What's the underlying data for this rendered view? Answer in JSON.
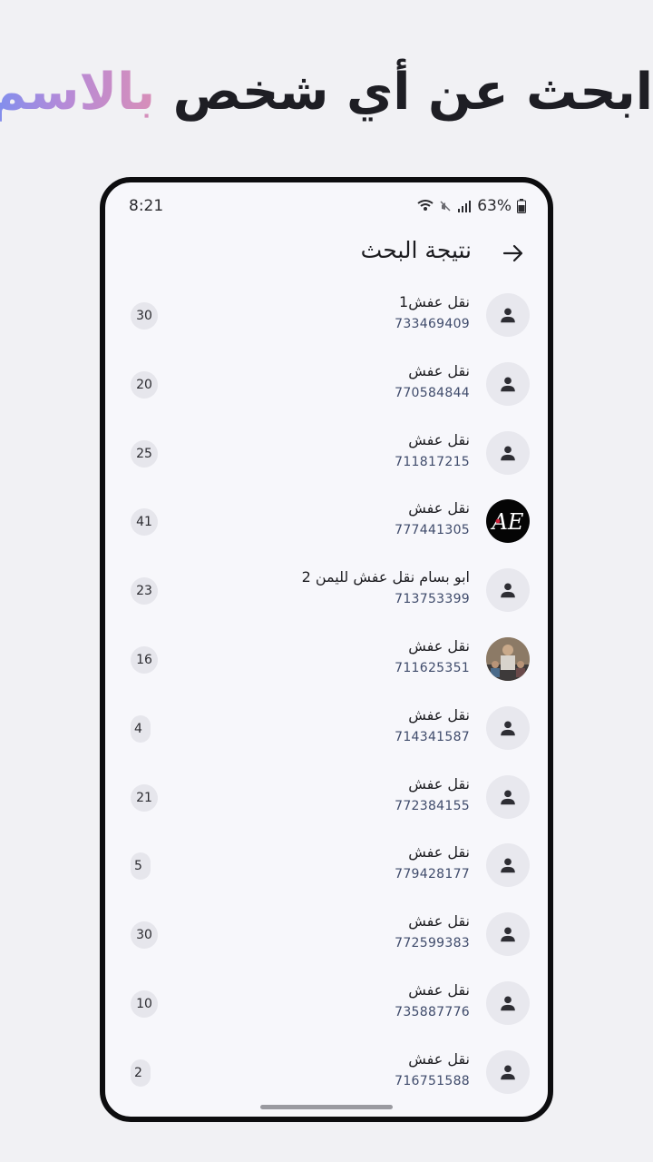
{
  "headline": {
    "part1": "ابحث عن أي شخص ",
    "accent": "بالاسم"
  },
  "status": {
    "time": "8:21",
    "battery": "63%"
  },
  "appbar": {
    "title": "نتيجة البحث"
  },
  "colors": {
    "accent_start": "#7b8ff0",
    "accent_end": "#d88fb8",
    "badge_bg": "#e6e6ec"
  },
  "results": [
    {
      "name": "نقل عفش1",
      "phone": "733469409",
      "count": "30",
      "avatar": "person-icon"
    },
    {
      "name": "نقل عفش",
      "phone": "770584844",
      "count": "20",
      "avatar": "person-icon"
    },
    {
      "name": "نقل عفش",
      "phone": "711817215",
      "count": "25",
      "avatar": "person-icon"
    },
    {
      "name": "نقل عفش",
      "phone": "777441305",
      "count": "41",
      "avatar": "logo"
    },
    {
      "name": "ابو بسام نقل عفش لليمن 2",
      "phone": "713753399",
      "count": "23",
      "avatar": "person-icon"
    },
    {
      "name": "نقل عفش",
      "phone": "711625351",
      "count": "16",
      "avatar": "photo"
    },
    {
      "name": "نقل عفش",
      "phone": "714341587",
      "count": "4",
      "avatar": "person-icon"
    },
    {
      "name": "نقل عفش",
      "phone": "772384155",
      "count": "21",
      "avatar": "person-icon"
    },
    {
      "name": "نقل عفش",
      "phone": "779428177",
      "count": "5",
      "avatar": "person-icon"
    },
    {
      "name": "نقل عفش",
      "phone": "772599383",
      "count": "30",
      "avatar": "person-icon"
    },
    {
      "name": "نقل عفش",
      "phone": "735887776",
      "count": "10",
      "avatar": "person-icon"
    },
    {
      "name": "نقل عفش",
      "phone": "716751588",
      "count": "2",
      "avatar": "person-icon"
    }
  ]
}
